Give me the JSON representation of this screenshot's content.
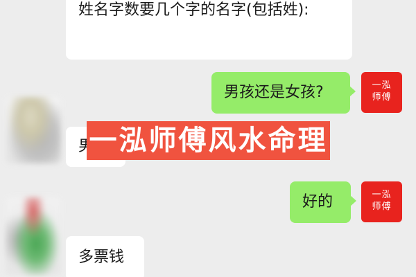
{
  "messages": [
    {
      "side": "incoming",
      "text": "姓名字数要几个字的名字(包括姓):"
    },
    {
      "side": "outgoing",
      "text": "男孩还是女孩?"
    },
    {
      "side": "incoming",
      "text": "男孩"
    },
    {
      "side": "outgoing",
      "text": "好的"
    },
    {
      "side": "incoming",
      "text": "多票钱"
    }
  ],
  "self_avatar": {
    "line1": "一泓",
    "line2": "师傅",
    "color": "#e8231e"
  },
  "watermark": {
    "text": "一泓师傅风水命理",
    "color": "#f0533f"
  },
  "colors": {
    "background": "#ededed",
    "incoming_bubble": "#ffffff",
    "outgoing_bubble": "#95ec69"
  }
}
